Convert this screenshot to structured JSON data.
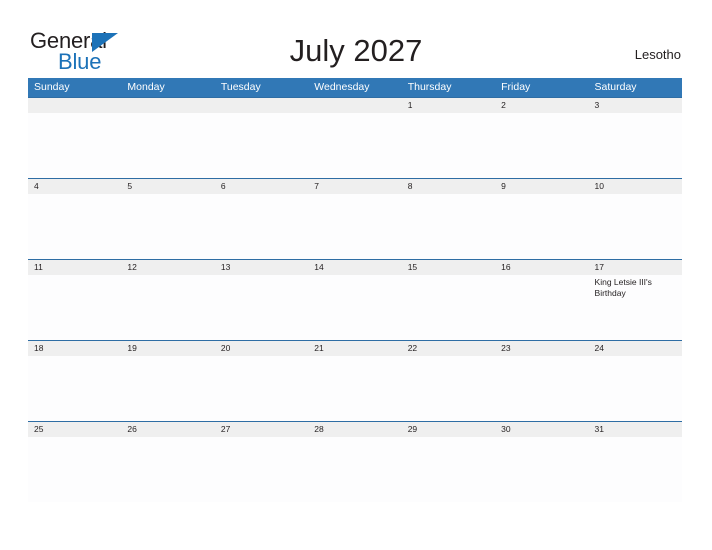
{
  "brand": {
    "line1": "General",
    "line2": "Blue",
    "triangle_color": "#1c72b8",
    "text_color": "#231f20"
  },
  "header": {
    "title": "July 2027",
    "country": "Lesotho"
  },
  "theme": {
    "header_blue": "#3178b6",
    "header_border": "#2e6da4",
    "day_band_gray": "#efefef",
    "cell_background": "#fdfdfe",
    "page_background": "#ffffff",
    "text": "#231f20"
  },
  "calendar": {
    "weekdays": [
      "Sunday",
      "Monday",
      "Tuesday",
      "Wednesday",
      "Thursday",
      "Friday",
      "Saturday"
    ],
    "weeks": [
      [
        {
          "day": "",
          "events": []
        },
        {
          "day": "",
          "events": []
        },
        {
          "day": "",
          "events": []
        },
        {
          "day": "",
          "events": []
        },
        {
          "day": "1",
          "events": []
        },
        {
          "day": "2",
          "events": []
        },
        {
          "day": "3",
          "events": []
        }
      ],
      [
        {
          "day": "4",
          "events": []
        },
        {
          "day": "5",
          "events": []
        },
        {
          "day": "6",
          "events": []
        },
        {
          "day": "7",
          "events": []
        },
        {
          "day": "8",
          "events": []
        },
        {
          "day": "9",
          "events": []
        },
        {
          "day": "10",
          "events": []
        }
      ],
      [
        {
          "day": "11",
          "events": []
        },
        {
          "day": "12",
          "events": []
        },
        {
          "day": "13",
          "events": []
        },
        {
          "day": "14",
          "events": []
        },
        {
          "day": "15",
          "events": []
        },
        {
          "day": "16",
          "events": []
        },
        {
          "day": "17",
          "events": [
            "King Letsie III's Birthday"
          ]
        }
      ],
      [
        {
          "day": "18",
          "events": []
        },
        {
          "day": "19",
          "events": []
        },
        {
          "day": "20",
          "events": []
        },
        {
          "day": "21",
          "events": []
        },
        {
          "day": "22",
          "events": []
        },
        {
          "day": "23",
          "events": []
        },
        {
          "day": "24",
          "events": []
        }
      ],
      [
        {
          "day": "25",
          "events": []
        },
        {
          "day": "26",
          "events": []
        },
        {
          "day": "27",
          "events": []
        },
        {
          "day": "28",
          "events": []
        },
        {
          "day": "29",
          "events": []
        },
        {
          "day": "30",
          "events": []
        },
        {
          "day": "31",
          "events": []
        }
      ]
    ]
  }
}
